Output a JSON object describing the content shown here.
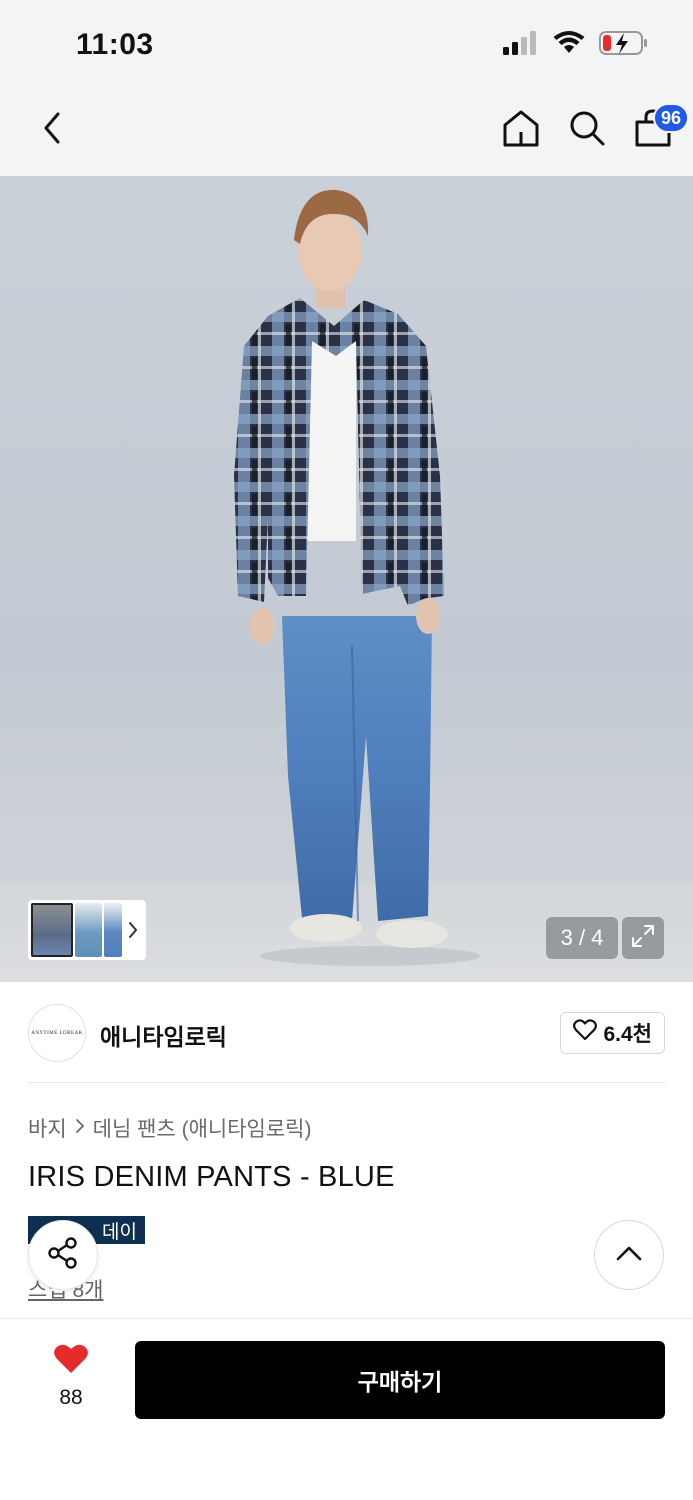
{
  "status_bar": {
    "time": "11:03",
    "icons": [
      "signal-icon",
      "wifi-icon",
      "battery-charging-icon"
    ]
  },
  "nav": {
    "icons": [
      "back-icon",
      "home-icon",
      "search-icon",
      "cart-icon"
    ],
    "cart_count": "96"
  },
  "gallery": {
    "counter": "3 / 4",
    "thumb_count": 3
  },
  "brand": {
    "logo_text": "ANYTIME LOREAK",
    "name": "애니타임로릭",
    "likes": "6.4천"
  },
  "breadcrumb": {
    "category": "바지",
    "subcategory": "데님 팬츠 (애니타임로릭)"
  },
  "product": {
    "title": "IRIS DENIM PANTS - BLUE",
    "promo_badge": "데이",
    "points_link": "스냅 8개"
  },
  "bottom_bar": {
    "wish_count": "88",
    "buy_label": "구매하기"
  },
  "colors": {
    "accent_blue": "#1f5be8",
    "heart_red": "#e52b2b",
    "badge_navy": "#0e2f4f",
    "buy_button": "#000000"
  }
}
